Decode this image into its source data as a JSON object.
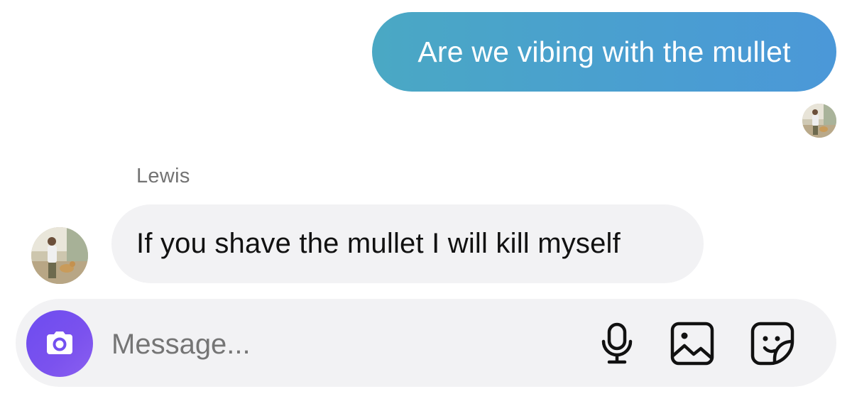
{
  "conversation": {
    "sent_message": {
      "text": "Are we vibing with the mullet"
    },
    "received_message": {
      "sender": "Lewis",
      "text": "If you shave the mullet I will kill myself"
    }
  },
  "composer": {
    "placeholder": "Message...",
    "icons": [
      "camera-icon",
      "microphone-icon",
      "image-icon",
      "sticker-icon"
    ]
  },
  "colors": {
    "sent_bubble": "#4a9fd0",
    "received_bubble": "#f2f2f4",
    "camera_button": "#7350f0"
  }
}
